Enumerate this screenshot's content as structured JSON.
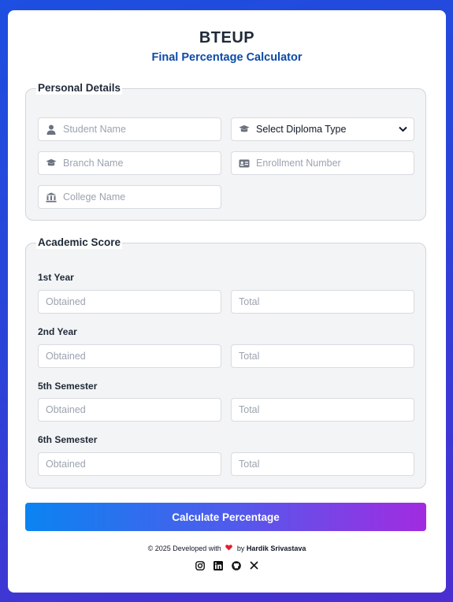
{
  "header": {
    "title": "BTEUP",
    "subtitle": "Final Percentage Calculator"
  },
  "personal": {
    "legend": "Personal Details",
    "student_name_placeholder": "Student Name",
    "diploma_select_value": "Select Diploma Type",
    "branch_name_placeholder": "Branch Name",
    "enrollment_placeholder": "Enrollment Number",
    "college_name_placeholder": "College Name",
    "icons": [
      "user-icon",
      "graduation-cap-icon",
      "graduation-cap-icon",
      "id-card-icon",
      "university-icon"
    ]
  },
  "academic": {
    "legend": "Academic Score",
    "rows": [
      {
        "label": "1st Year",
        "obtained_placeholder": "Obtained",
        "total_placeholder": "Total"
      },
      {
        "label": "2nd Year",
        "obtained_placeholder": "Obtained",
        "total_placeholder": "Total"
      },
      {
        "label": "5th Semester",
        "obtained_placeholder": "Obtained",
        "total_placeholder": "Total"
      },
      {
        "label": "6th Semester",
        "obtained_placeholder": "Obtained",
        "total_placeholder": "Total"
      }
    ]
  },
  "action": {
    "calculate_label": "Calculate Percentage"
  },
  "footer": {
    "prefix": "© 2025 Developed with",
    "by": "by",
    "author": "Hardik Srivastava",
    "socials": [
      "instagram-icon",
      "linkedin-icon",
      "github-icon",
      "x-icon"
    ]
  },
  "colors": {
    "accent": "#0d4aa8",
    "button_start": "#0a84f0",
    "button_end": "#a22be0",
    "heart": "#e11d2e"
  }
}
